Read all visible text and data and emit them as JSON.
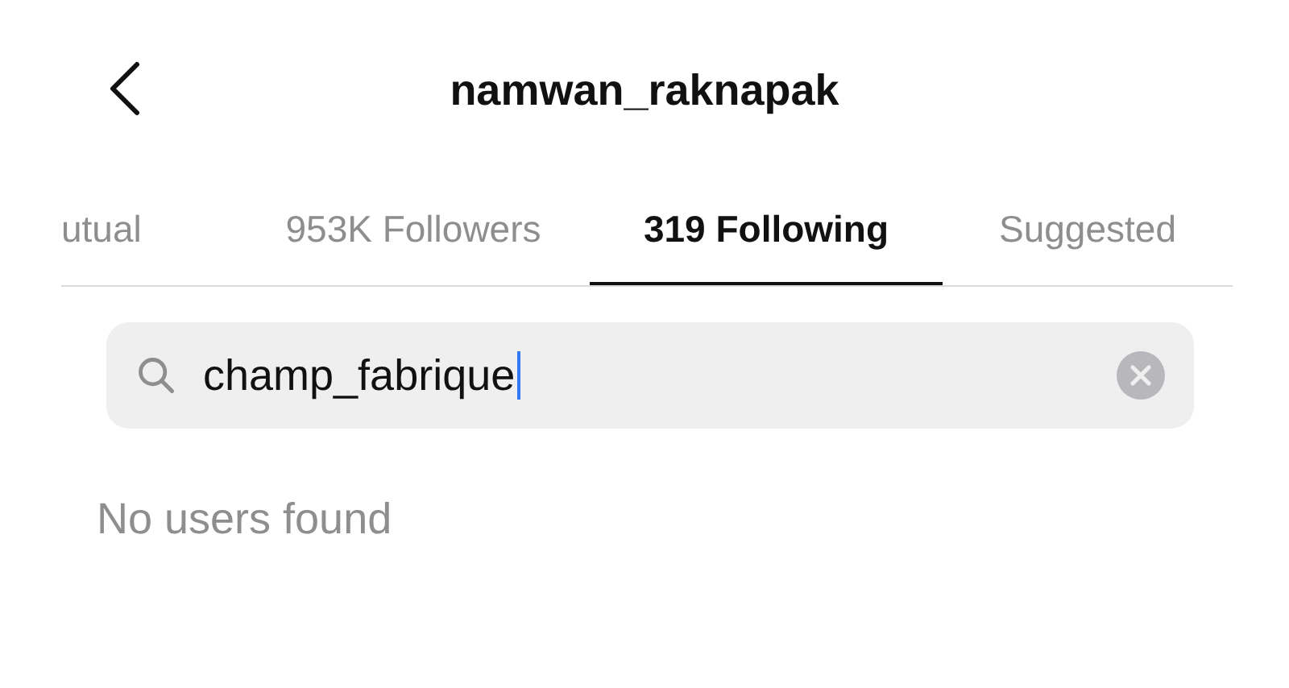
{
  "header": {
    "title": "namwan_raknapak"
  },
  "tabs": [
    {
      "label": "utual",
      "selected": false
    },
    {
      "label": "953K Followers",
      "selected": false
    },
    {
      "label": "319 Following",
      "selected": true
    },
    {
      "label": "Suggested",
      "selected": false
    }
  ],
  "search": {
    "value": "champ_fabrique"
  },
  "empty_message": "No users found"
}
